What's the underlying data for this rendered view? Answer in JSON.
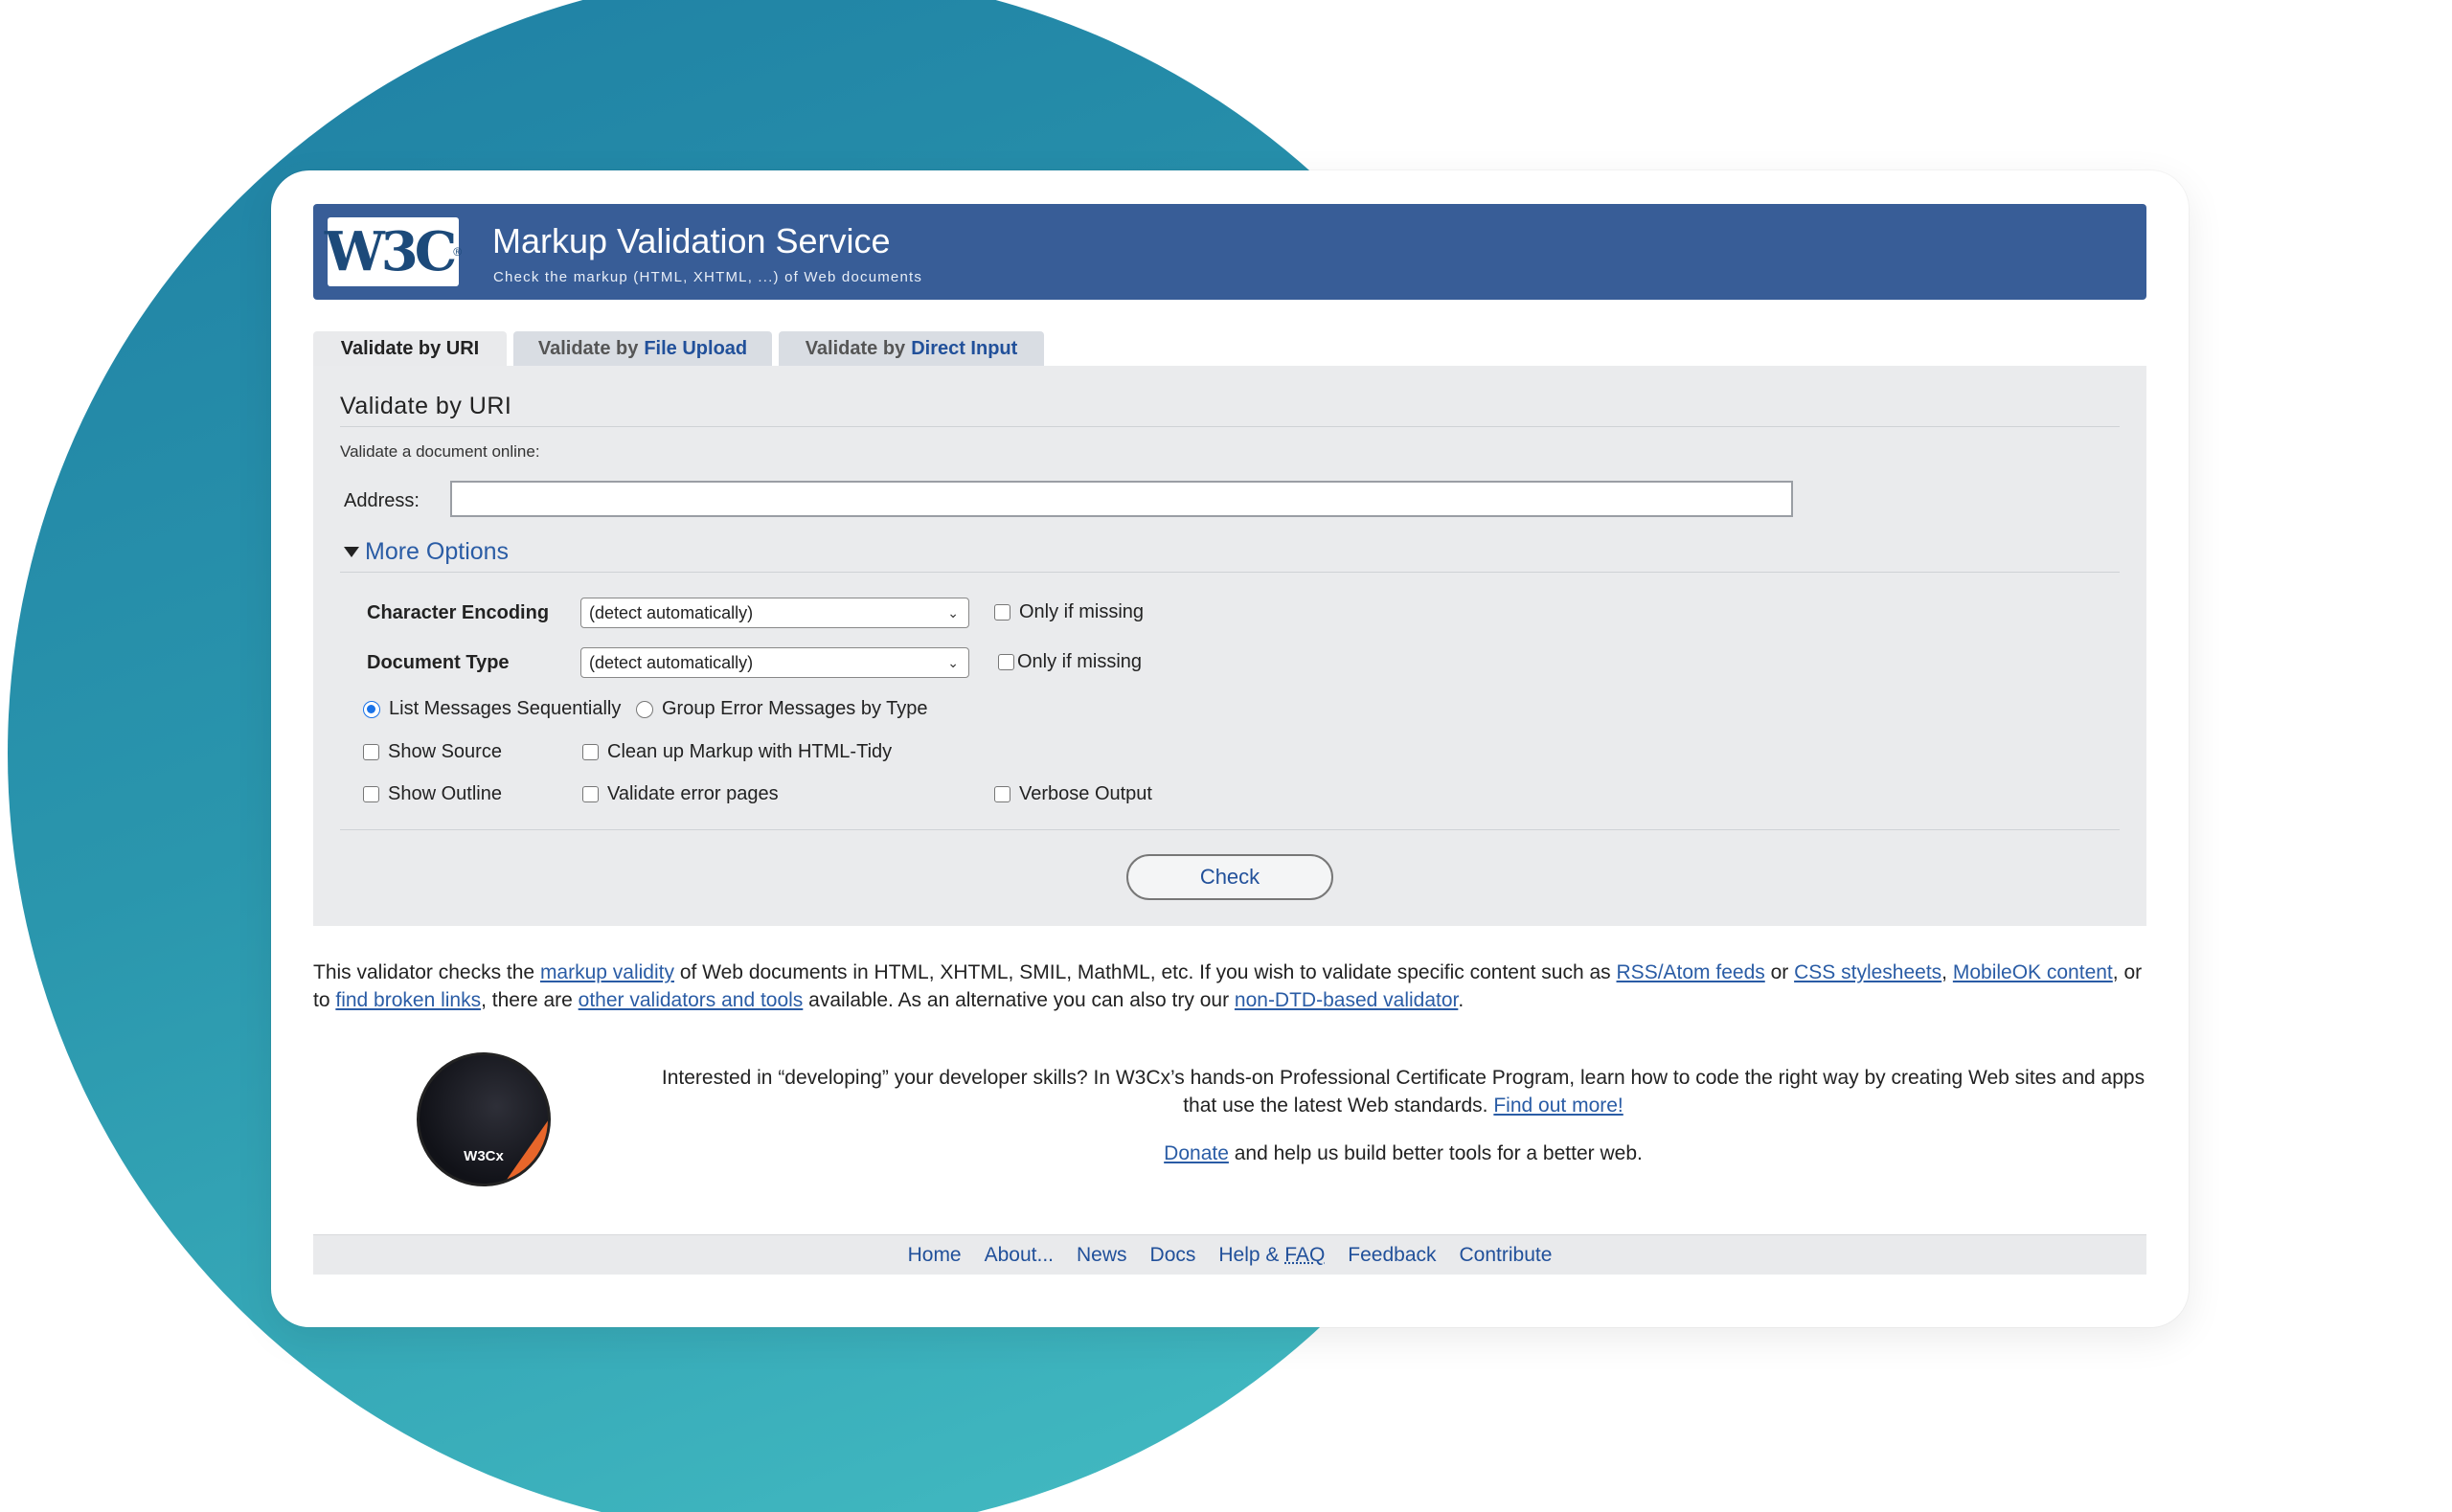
{
  "banner": {
    "logo_text": "W3C",
    "logo_reg": "®",
    "title": "Markup Validation Service",
    "subtitle": "Check the markup (HTML, XHTML, ...) of Web documents"
  },
  "tabs": [
    {
      "prefix": "Validate by URI",
      "highlight": ""
    },
    {
      "prefix": "Validate by",
      "highlight": "File Upload"
    },
    {
      "prefix": "Validate by",
      "highlight": "Direct Input"
    }
  ],
  "form": {
    "section_title": "Validate by URI",
    "intro": "Validate a document online:",
    "address_label": "Address:",
    "address_value": "",
    "more_options": "More Options",
    "char_encoding_label": "Character Encoding",
    "char_encoding_value": "(detect automatically)",
    "doc_type_label": "Document Type",
    "doc_type_value": "(detect automatically)",
    "only_if_missing": "Only if missing",
    "radio_sequential": "List Messages Sequentially",
    "radio_group": "Group Error Messages by Type",
    "show_source": "Show Source",
    "cleanup": "Clean up Markup with HTML-Tidy",
    "show_outline": "Show Outline",
    "validate_error_pages": "Validate error pages",
    "verbose": "Verbose Output",
    "check_button": "Check"
  },
  "description": {
    "t1": "This validator checks the ",
    "l1": "markup validity",
    "t2": " of Web documents in HTML, XHTML, SMIL, MathML, etc. If you wish to validate specific content such as ",
    "l2": "RSS/Atom feeds",
    "t3": " or ",
    "l3": "CSS stylesheets",
    "t4": ", ",
    "l4": "MobileOK content",
    "t5": ", or to ",
    "l5": "find broken links",
    "t6": ", there are ",
    "l6": "other validators and tools",
    "t7": " available. As an alternative you can also try our ",
    "l7": "non-DTD-based validator",
    "t8": "."
  },
  "badge": {
    "text": "W3Cx"
  },
  "promo": {
    "text": "Interested in “developing” your developer skills? In W3Cx’s hands-on Professional Certificate Program, learn how to code the right way by creating Web sites and apps that use the latest Web standards. ",
    "link": "Find out more!"
  },
  "donate": {
    "link": "Donate",
    "text": " and help us build better tools for a better web."
  },
  "footer": {
    "home": "Home",
    "about": "About...",
    "news": "News",
    "docs": "Docs",
    "help": "Help & ",
    "faq": "FAQ",
    "feedback": "Feedback",
    "contribute": "Contribute"
  }
}
